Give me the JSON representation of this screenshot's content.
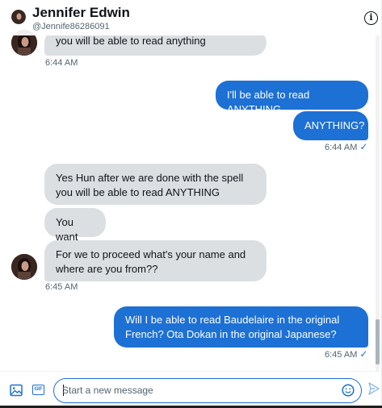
{
  "header": {
    "name": "Jennifer Edwin",
    "handle": "@Jennife86286091",
    "info_icon": "info-icon"
  },
  "messages": [
    {
      "direction": "in",
      "text": "you will be able to read anything"
    },
    {
      "direction": "in_time",
      "text": "6:44 AM"
    },
    {
      "direction": "out",
      "text": "I'll be able to read ANYTHING."
    },
    {
      "direction": "out",
      "text": "ANYTHING?"
    },
    {
      "direction": "out_time",
      "text": "6:44 AM",
      "status": "✓"
    },
    {
      "direction": "in",
      "text": "Yes Hun after we are done with the spell you will be able to read ANYTHING"
    },
    {
      "direction": "in",
      "text": "You want"
    },
    {
      "direction": "in",
      "text": "For we to proceed what's your name and where are you from??"
    },
    {
      "direction": "in_time",
      "text": "6:45 AM"
    },
    {
      "direction": "out",
      "text": "Will I be able to read Baudelaire in the original French?  Ota Dokan in the original Japanese?"
    },
    {
      "direction": "out_time",
      "text": "6:45 AM",
      "status": "✓"
    }
  ],
  "composer": {
    "placeholder": "Start a new message",
    "media_icon": "image-icon",
    "gif_label": "GIF",
    "emoji_icon": "emoji-icon",
    "send_icon": "send-icon"
  },
  "colors": {
    "accent": "#1d70d4",
    "incoming_bubble": "#dcdfe2",
    "muted_text": "#536471"
  }
}
